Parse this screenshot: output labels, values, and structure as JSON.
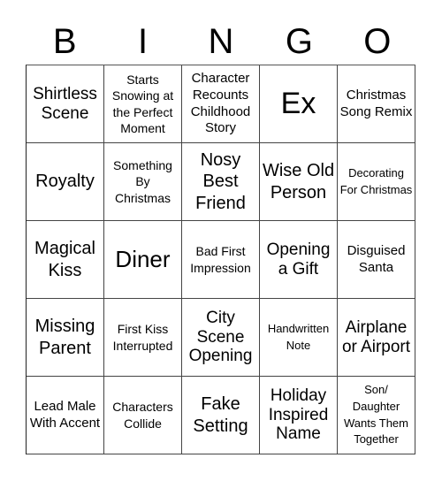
{
  "header": [
    "B",
    "I",
    "N",
    "G",
    "O"
  ],
  "cells": [
    [
      "Shirtless Scene",
      "Starts Snowing at the Perfect Moment",
      "Character Recounts Childhood Story",
      "Ex",
      "Christmas Song Remix"
    ],
    [
      "Royalty",
      "Something By Christmas",
      "Nosy Best Friend",
      "Wise Old Person",
      "Decorating For Christmas"
    ],
    [
      "Magical Kiss",
      "Diner",
      "Bad First Impression",
      "Opening a Gift",
      "Disguised Santa"
    ],
    [
      "Missing Parent",
      "First Kiss Interrupted",
      "City Scene Opening",
      "Handwritten Note",
      "Airplane or Airport"
    ],
    [
      "Lead Male With Accent",
      "Characters Collide",
      "Fake Setting",
      "Holiday Inspired Name",
      "Son/ Daughter Wants Them Together"
    ]
  ]
}
